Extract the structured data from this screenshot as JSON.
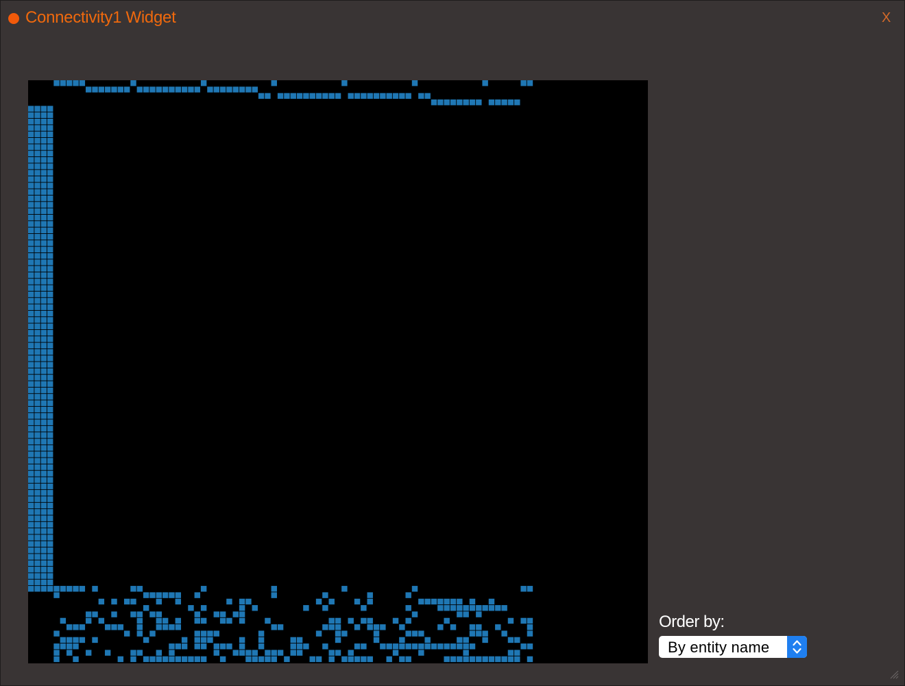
{
  "window": {
    "title": "Connectivity1 Widget",
    "close_label": "X"
  },
  "controls": {
    "order_by_label": "Order by:",
    "order_by_value": "By entity name"
  },
  "matrix": {
    "cell_color": "#1f77b4",
    "background": "#000000"
  },
  "colors": {
    "accent": "#f0690d",
    "panel": "#393434",
    "select_arrow": "#1f7ff0"
  }
}
